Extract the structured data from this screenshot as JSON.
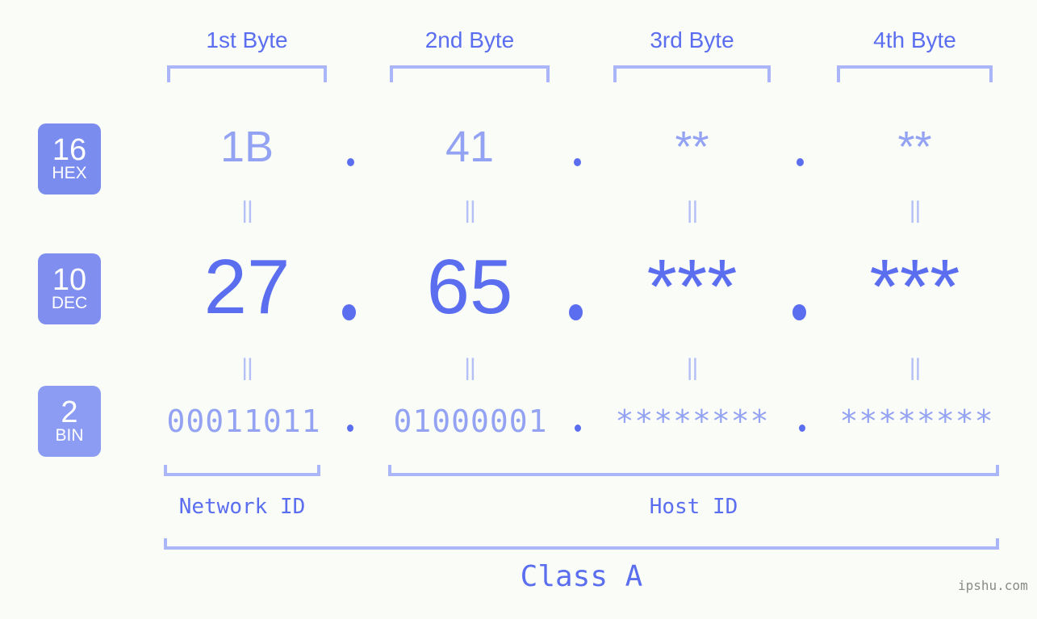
{
  "background_color": "#fafdf7",
  "colors": {
    "accent_strong": "#5b6ef0",
    "accent_light": "#93a2f2",
    "bracket": "#aab6f7",
    "badge_hex": "#7b8cef",
    "badge_dec": "#808fef",
    "badge_bin": "#8d9cf3",
    "watermark": "#8a8a8a"
  },
  "byte_headers": [
    {
      "label": "1st Byte"
    },
    {
      "label": "2nd Byte"
    },
    {
      "label": "3rd Byte"
    },
    {
      "label": "4th Byte"
    }
  ],
  "rows": [
    {
      "badge": {
        "number": "16",
        "name": "HEX"
      },
      "values": [
        "1B",
        "41",
        "**",
        "**"
      ],
      "separator": "."
    },
    {
      "badge": {
        "number": "10",
        "name": "DEC"
      },
      "values": [
        "27",
        "65",
        "***",
        "***"
      ],
      "separator": "."
    },
    {
      "badge": {
        "number": "2",
        "name": "BIN"
      },
      "values": [
        "00011011",
        "01000001",
        "********",
        "********"
      ],
      "separator": "."
    }
  ],
  "equals_symbol": "||",
  "sections": [
    {
      "label": "Network ID"
    },
    {
      "label": "Host ID"
    }
  ],
  "class_label": "Class A",
  "watermark": "ipshu.com"
}
